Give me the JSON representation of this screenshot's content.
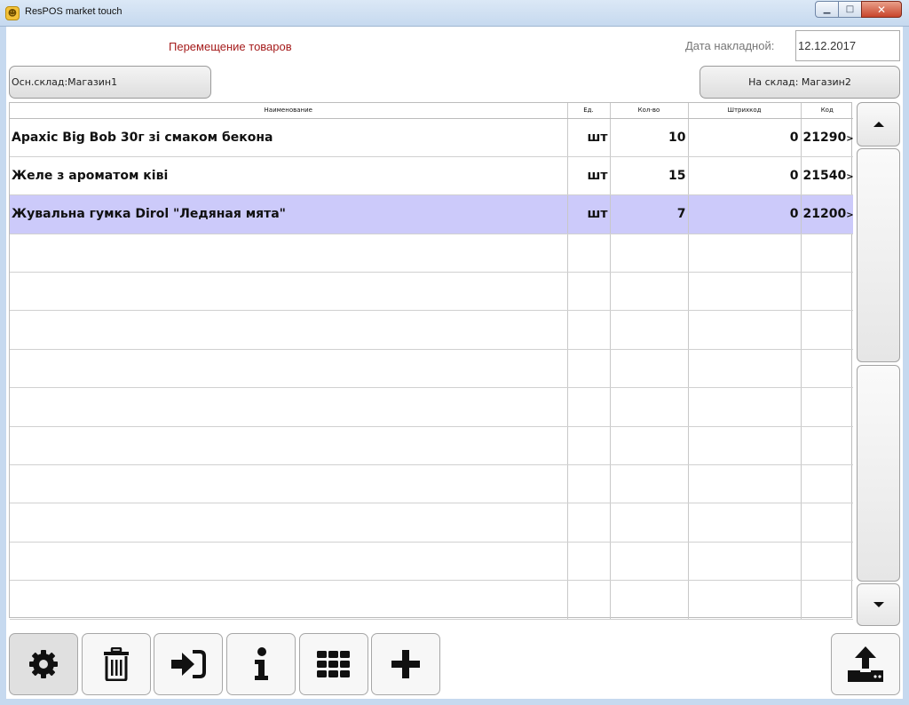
{
  "window": {
    "title": "ResPOS market touch",
    "icon": "app-logo-icon"
  },
  "document": {
    "title": "Перемещение товаров",
    "date_label": "Дата накладной:",
    "date_value": "12.12.2017"
  },
  "warehouses": {
    "from_label": "Осн.склад:Магазин1",
    "to_label": "На склад: Магазин2"
  },
  "table": {
    "columns": {
      "name": "Наименование",
      "unit": "Ед.",
      "qty": "Кол-во",
      "barcode": "Штрихкод",
      "code": "Код"
    },
    "rows": [
      {
        "name": "Apaxic Big Bob 30г зі смаком бекона",
        "unit": "шт",
        "qty": "10",
        "barcode": "0",
        "code": "21290",
        "code_suffix": ">",
        "selected": false
      },
      {
        "name": "Желе з ароматом ківі",
        "unit": "шт",
        "qty": "15",
        "barcode": "0",
        "code": "21540",
        "code_suffix": ">",
        "selected": false
      },
      {
        "name": "Жувальна гумка Dirol \"Ледяная мята\"",
        "unit": "шт",
        "qty": "7",
        "barcode": "0",
        "code": "21200",
        "code_suffix": ">",
        "selected": true
      }
    ],
    "empty_rows": 10,
    "selection_color": "#cccafa"
  },
  "scroll": {
    "up_icon": "caret-up-icon",
    "down_icon": "caret-down-icon"
  },
  "toolbar": {
    "buttons": [
      {
        "name": "settings-button",
        "icon": "gear-icon"
      },
      {
        "name": "delete-button",
        "icon": "trash-icon"
      },
      {
        "name": "login-button",
        "icon": "sign-in-icon"
      },
      {
        "name": "info-button",
        "icon": "info-icon"
      },
      {
        "name": "keypad-button",
        "icon": "keypad-grid-icon"
      },
      {
        "name": "add-button",
        "icon": "plus-icon"
      }
    ],
    "upload_icon": "upload-icon"
  },
  "colors": {
    "title_red": "#a51c1c",
    "close_red": "#c8452c",
    "titlebar_blue": "#c6d9ef"
  }
}
